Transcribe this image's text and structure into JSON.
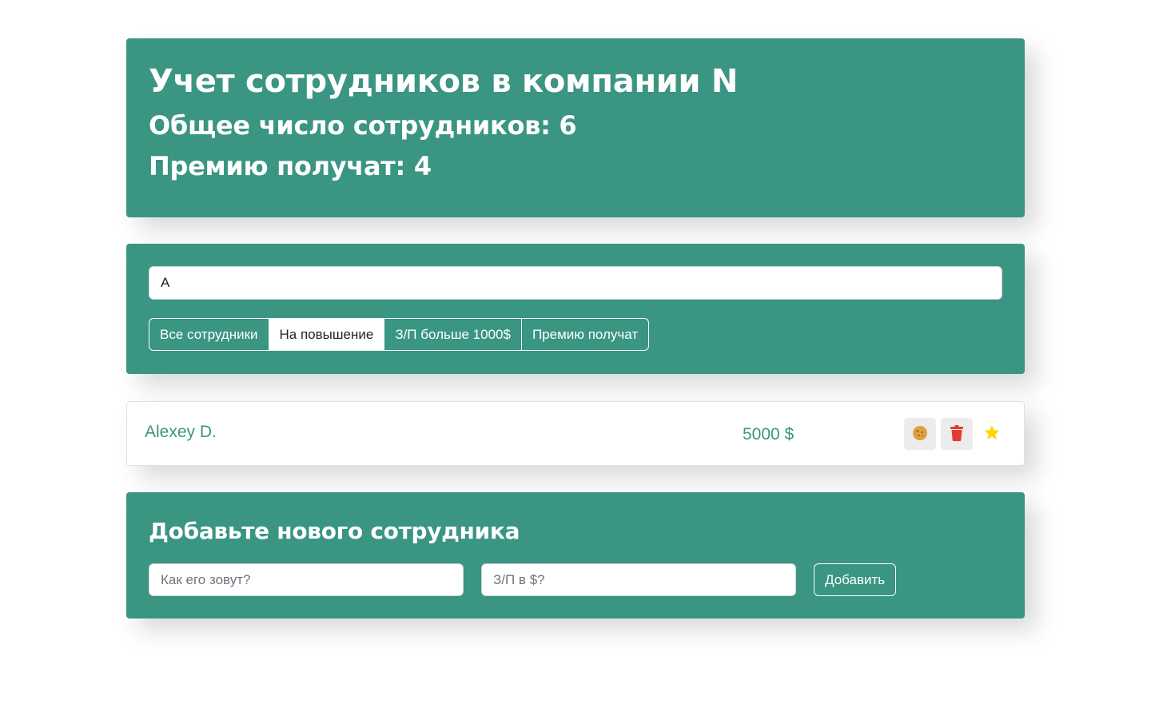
{
  "header": {
    "title": "Учет сотрудников в компании N",
    "total": "Общее число сотрудников: 6",
    "bonus": "Премию получат: 4"
  },
  "search": {
    "value": "A",
    "filters": [
      {
        "label": "Все сотрудники",
        "active": false
      },
      {
        "label": "На повышение",
        "active": true
      },
      {
        "label": "З/П больше 1000$",
        "active": false
      },
      {
        "label": "Премию получат",
        "active": false
      }
    ]
  },
  "employees": [
    {
      "name": "Alexey D.",
      "salary": "5000 $"
    }
  ],
  "add_form": {
    "title": "Добавьте нового сотрудника",
    "name_placeholder": "Как его зовут?",
    "salary_placeholder": "З/П в $?",
    "submit_label": "Добавить"
  },
  "colors": {
    "accent": "#3a9582",
    "delete": "#e53935",
    "cookie": "#e0a040",
    "star": "#ffd700"
  },
  "icons": [
    "cookie-icon",
    "trash-icon",
    "star-icon"
  ]
}
